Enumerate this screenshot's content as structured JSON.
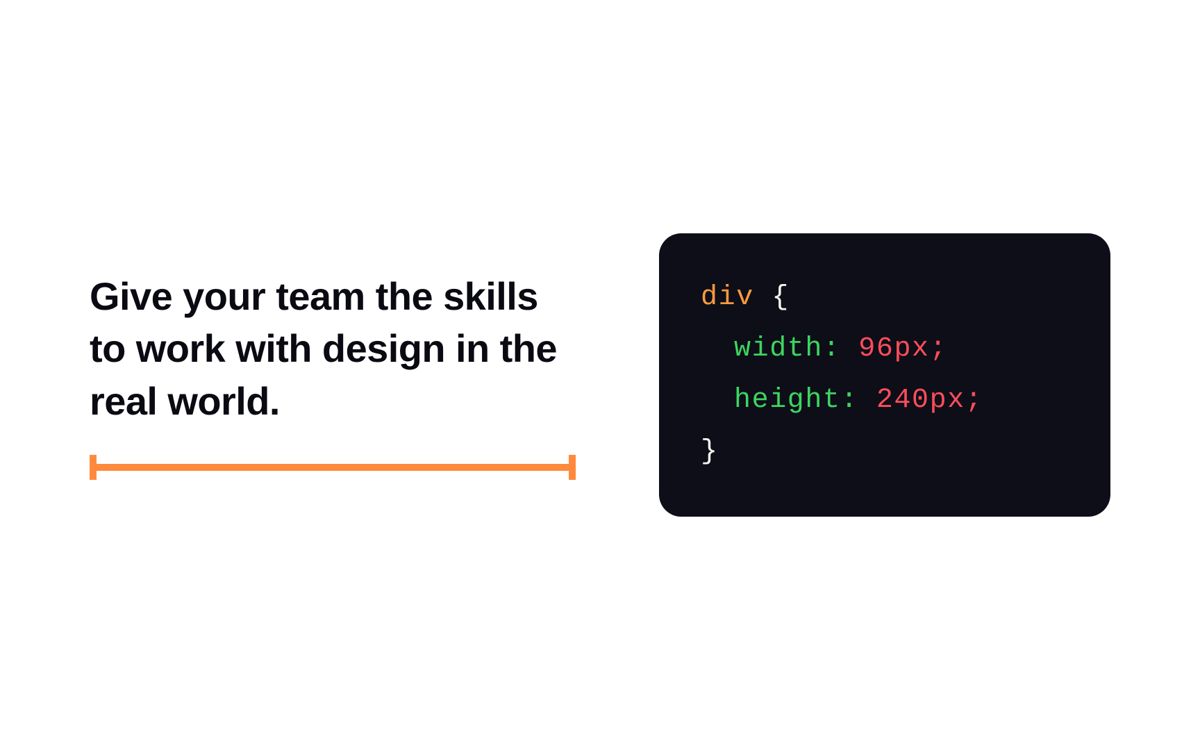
{
  "headline": "Give your team the skills to work with design in the real world.",
  "colors": {
    "accent": "#ff8a3d",
    "code_bg": "#0d0e18",
    "selector": "#ff9a3d",
    "brace": "#f5f5f0",
    "prop": "#3dd560",
    "value": "#ff4d5a"
  },
  "code": {
    "selector": "div",
    "open_brace": " {",
    "close_brace": "}",
    "rules": [
      {
        "prop": "width",
        "colon": ": ",
        "value": "96px",
        "semi": ";"
      },
      {
        "prop": "height",
        "colon": ": ",
        "value": "240px",
        "semi": ";"
      }
    ]
  }
}
